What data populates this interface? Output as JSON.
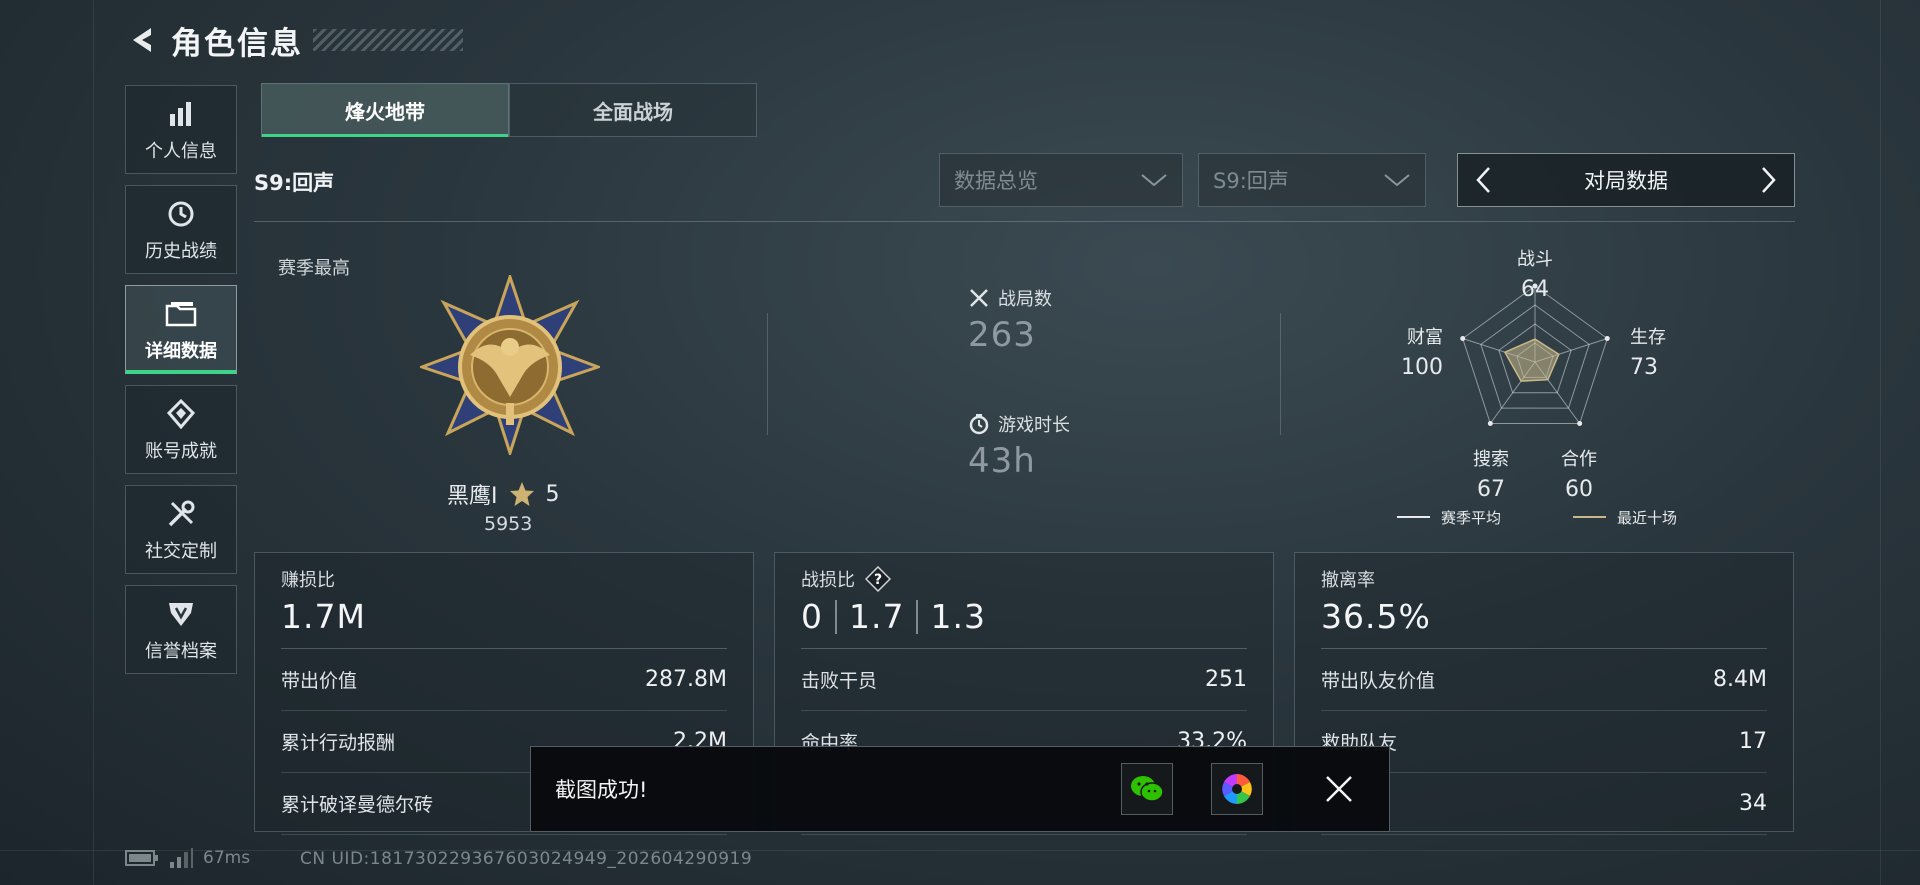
{
  "header": {
    "title": "角色信息"
  },
  "sidebar": {
    "items": [
      {
        "label": "个人信息",
        "icon": "bar-chart-icon"
      },
      {
        "label": "历史战绩",
        "icon": "history-clock-icon"
      },
      {
        "label": "详细数据",
        "icon": "folder-icon",
        "active": true
      },
      {
        "label": "账号成就",
        "icon": "achievement-icon"
      },
      {
        "label": "社交定制",
        "icon": "tools-icon"
      },
      {
        "label": "信誉档案",
        "icon": "shield-icon"
      }
    ]
  },
  "mode_tabs": [
    {
      "label": "烽火地带",
      "active": true
    },
    {
      "label": "全面战场",
      "active": false
    }
  ],
  "filters": {
    "season_label": "S9:回声",
    "overview_dropdown": "数据总览",
    "season_dropdown": "S9:回声",
    "pager_label": "对局数据"
  },
  "overview": {
    "season_best_label": "赛季最高",
    "rank_name": "黑鹰I",
    "rank_stars": "5",
    "rank_score": "5953",
    "matches_label": "战局数",
    "matches_value": "263",
    "playtime_label": "游戏时长",
    "playtime_value": "43h"
  },
  "radar": {
    "axes": [
      {
        "label": "战斗",
        "value": "64"
      },
      {
        "label": "生存",
        "value": "73"
      },
      {
        "label": "合作",
        "value": "60"
      },
      {
        "label": "搜索",
        "value": "67"
      },
      {
        "label": "财富",
        "value": "100"
      }
    ],
    "legend": [
      {
        "label": "赛季平均",
        "color": "#e6eaec"
      },
      {
        "label": "最近十场",
        "color": "#c9b98a"
      }
    ]
  },
  "cards": {
    "profit": {
      "title": "赚损比",
      "value": "1.7M",
      "rows": [
        {
          "label": "带出价值",
          "value": "287.8M"
        },
        {
          "label": "累计行动报酬",
          "value": "2.2M"
        },
        {
          "label": "累计破译曼德尔砖",
          "value": ""
        }
      ]
    },
    "kd": {
      "title": "战损比",
      "values": [
        "0",
        "1.7",
        "1.3"
      ],
      "rows": [
        {
          "label": "击败干员",
          "value": "251"
        },
        {
          "label": "命中率",
          "value": "33.2%"
        },
        {
          "label": "",
          "value": ""
        }
      ]
    },
    "extract": {
      "title": "撤离率",
      "value": "36.5%",
      "rows": [
        {
          "label": "带出队友价值",
          "value": "8.4M"
        },
        {
          "label": "救助队友",
          "value": "17"
        },
        {
          "label": "",
          "value": "34"
        }
      ]
    }
  },
  "status": {
    "ping": "67ms",
    "uid": "CN UID:18173022936760302494​9_202604290919"
  },
  "toast": {
    "message": "截图成功!"
  },
  "colors": {
    "accent": "#3fd38a",
    "background": "#2a363d"
  }
}
